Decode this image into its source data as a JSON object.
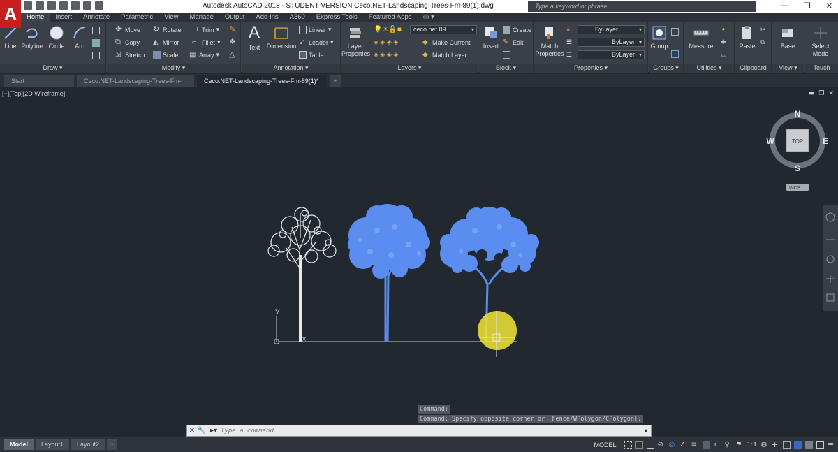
{
  "window": {
    "logo": "A",
    "title": "Autodesk AutoCAD 2018 - STUDENT VERSION    Ceco.NET-Landscaping-Trees-Fm-89(1).dwg",
    "search_placeholder": "Type a keyword or phrase"
  },
  "ribbon_tabs": [
    "Home",
    "Insert",
    "Annotate",
    "Parametric",
    "View",
    "Manage",
    "Output",
    "Add-ins",
    "A360",
    "Express Tools",
    "Featured Apps"
  ],
  "panels": {
    "draw": {
      "label": "Draw ▾",
      "line": "Line",
      "polyline": "Polyline",
      "circle": "Circle",
      "arc": "Arc"
    },
    "modify": {
      "label": "Modify ▾",
      "move": "Move",
      "rotate": "Rotate",
      "trim": "Trim",
      "copy": "Copy",
      "mirror": "Mirror",
      "fillet": "Fillet",
      "stretch": "Stretch",
      "scale": "Scale",
      "array": "Array"
    },
    "annotation": {
      "label": "Annotation ▾",
      "text": "Text",
      "dimension": "Dimension",
      "linear": "Linear",
      "leader": "Leader",
      "table": "Table"
    },
    "layers": {
      "label": "Layers ▾",
      "layer_properties": "Layer Properties",
      "layer_value": "ceco.net 89",
      "make_current": "Make Current",
      "match_layer": "Match Layer"
    },
    "block": {
      "label": "Block ▾",
      "insert": "Insert",
      "create": "Create",
      "edit": "Edit"
    },
    "properties": {
      "label": "Properties ▾",
      "match": "Match Properties",
      "color": "ByLayer",
      "linetype": "ByLayer",
      "lineweight": "ByLayer"
    },
    "groups": {
      "label": "Groups ▾",
      "group": "Group"
    },
    "utilities": {
      "label": "Utilities ▾",
      "measure": "Measure"
    },
    "clipboard": {
      "label": "Clipboard",
      "paste": "Paste"
    },
    "view": {
      "label": "View ▾",
      "base": "Base"
    },
    "touch": {
      "label": "Touch",
      "select_mode": "Select Mode"
    }
  },
  "file_tabs": [
    "Start",
    "Ceco.NET-Landscaping-Trees-Fm-78*",
    "Ceco.NET-Landscaping-Trees-Fm-89(1)*"
  ],
  "viewport": {
    "label": "[−][Top][2D Wireframe]",
    "viewcube": {
      "n": "N",
      "s": "S",
      "e": "E",
      "w": "W",
      "face": "TOP",
      "wcs": "WCS"
    },
    "ucs_y": "Y"
  },
  "command": {
    "history": [
      "Command:",
      "Command: Specify opposite corner or [Fence/WPolygon/CPolygon]:"
    ],
    "placeholder": "Type a command"
  },
  "layout_tabs": [
    "Model",
    "Layout1",
    "Layout2"
  ],
  "status": {
    "mode": "MODEL",
    "scale": "1:1"
  },
  "colors": {
    "accent_blue": "#5b8df0",
    "tree_white": "#e8e8e8",
    "highlight": "#f2e532"
  }
}
